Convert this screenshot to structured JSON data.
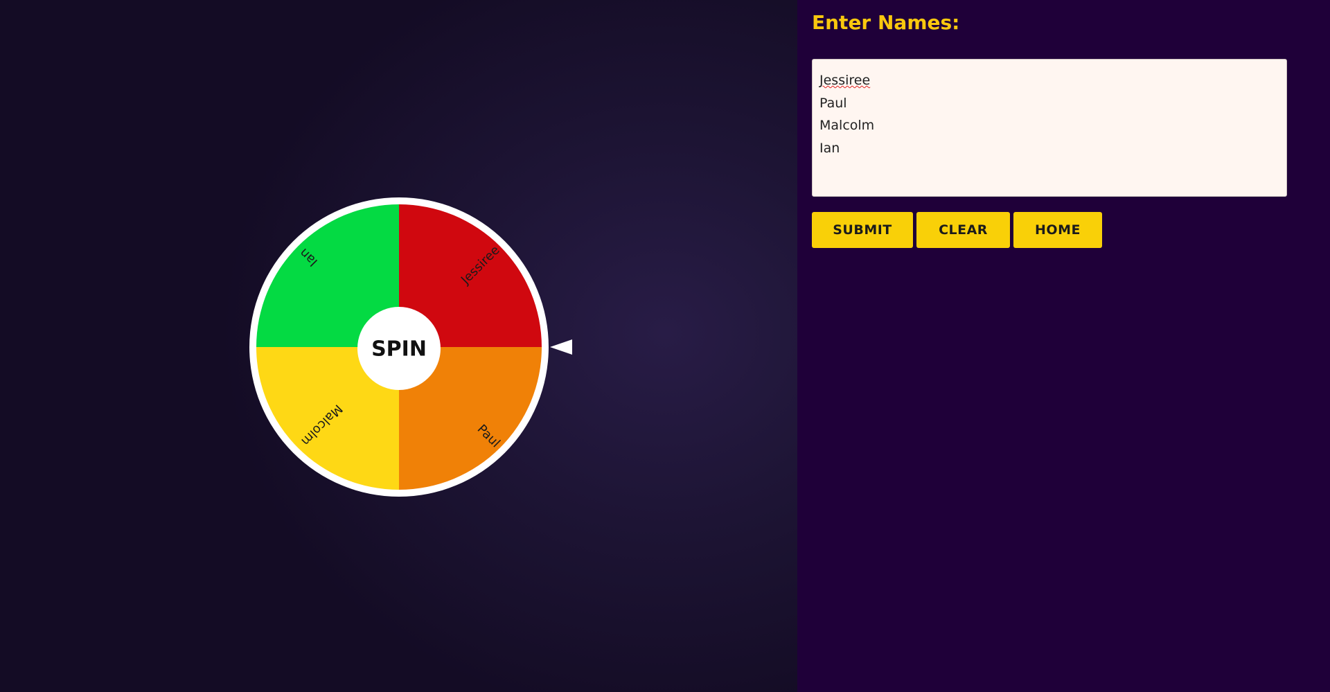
{
  "panel": {
    "heading": "Enter Names:"
  },
  "names": [
    "Jessiree",
    "Paul",
    "Malcolm",
    "Ian"
  ],
  "buttons": {
    "submit": "SUBMIT",
    "clear": "CLEAR",
    "home": "HOME"
  },
  "wheel": {
    "center_label": "SPIN",
    "slices": [
      {
        "label": "Jessiree",
        "color": "#d0080f"
      },
      {
        "label": "Paul",
        "color": "#f08107"
      },
      {
        "label": "Malcolm",
        "color": "#fed815"
      },
      {
        "label": "Ian",
        "color": "#04da43"
      }
    ],
    "rim_color": "#ffffff",
    "pointer_color": "#ffffff"
  },
  "colors": {
    "accent": "#f9c80e",
    "button_bg": "#f9d008",
    "panel_bg": "#1f0039",
    "textarea_bg": "#fff6f1"
  }
}
